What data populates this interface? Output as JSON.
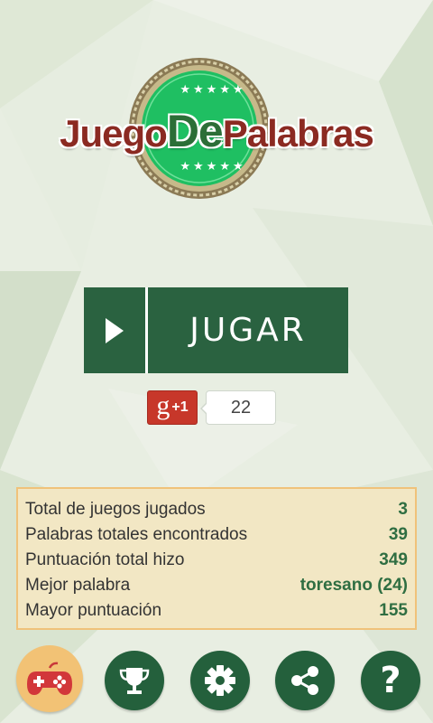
{
  "logo": {
    "title_part1": "Juego",
    "title_part2": "De",
    "title_part3": "Palabras",
    "stars_top": "★★★★★",
    "stars_bottom": "★★★★★"
  },
  "play_button": {
    "label": "JUGAR"
  },
  "google_plus": {
    "g_label": "g",
    "plus_label": "+1",
    "count": "22"
  },
  "stats": [
    {
      "label": "Total de juegos jugados",
      "value": "3"
    },
    {
      "label": "Palabras totales encontrados",
      "value": "39"
    },
    {
      "label": "Puntuación total hizo",
      "value": "349"
    },
    {
      "label": "Mejor palabra",
      "value": "toresano (24)"
    },
    {
      "label": "Mayor puntuación",
      "value": "155"
    }
  ],
  "nav": {
    "items": [
      {
        "icon": "gamepad-icon",
        "active": true
      },
      {
        "icon": "trophy-icon",
        "active": false
      },
      {
        "icon": "gear-icon",
        "active": false
      },
      {
        "icon": "share-icon",
        "active": false
      },
      {
        "icon": "help-icon",
        "active": false
      }
    ],
    "help_glyph": "?"
  },
  "colors": {
    "primary_green": "#2a6240",
    "logo_red": "#8b2a22",
    "logo_green": "#2c6e37",
    "panel_bg": "#f2e7c4",
    "panel_border": "#f0c27a",
    "value_green": "#2f6e42",
    "active_nav": "#f2c275",
    "gplus_red": "#c7372a"
  }
}
